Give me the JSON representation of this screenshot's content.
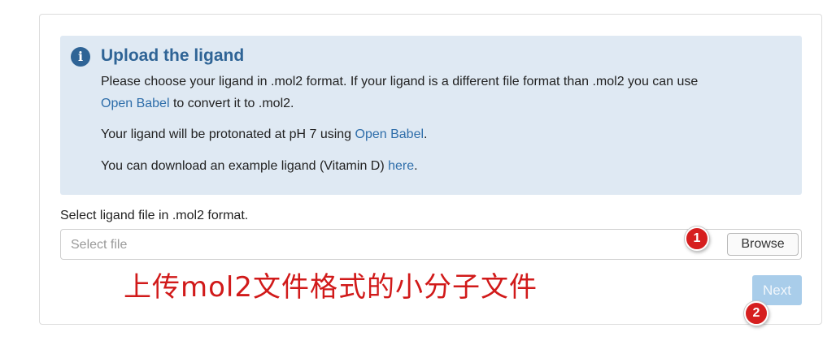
{
  "info": {
    "icon": "info-icon",
    "icon_glyph": "i",
    "title": "Upload the ligand",
    "line1_text": "Please choose your ligand in .mol2 format. If your ligand is a different file format than .mol2 you can use",
    "line2_link": "Open Babel",
    "line2_text": " to convert it to .mol2.",
    "line3_text": "Your ligand will be protonated at pH 7 using ",
    "line3_link": "Open Babel",
    "line3_end": ".",
    "line4_text": "You can download an example ligand (Vitamin D) ",
    "line4_link": "here",
    "line4_end": "."
  },
  "form": {
    "label": "Select ligand file in .mol2 format.",
    "placeholder": "Select file",
    "browse_label": "Browse",
    "next_label": "Next"
  },
  "annotations": {
    "badge1": "1",
    "badge2": "2",
    "caption": "上传mol2文件格式的小分子文件"
  },
  "colors": {
    "accent": "#2f6496",
    "link": "#2f6eaa",
    "info_bg": "#dfe9f3",
    "badge": "#d61f1f",
    "next_disabled": "#a9cdea"
  }
}
